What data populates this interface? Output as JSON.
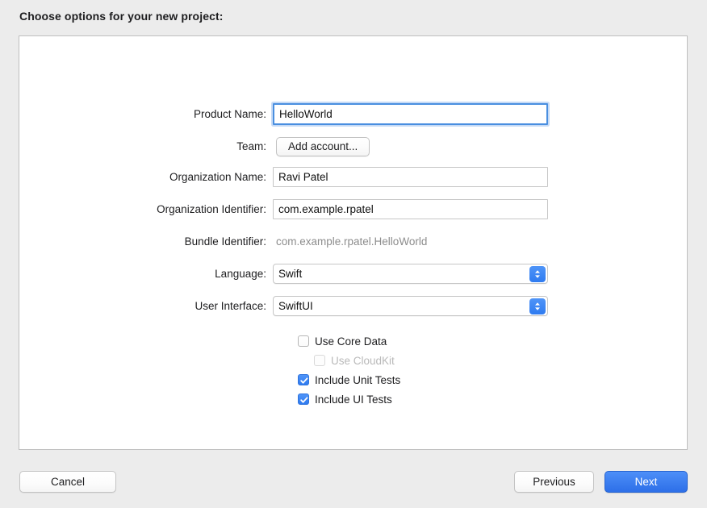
{
  "dialog": {
    "title": "Choose options for your new project:"
  },
  "form": {
    "fields": [
      {
        "label": "Product Name:",
        "type": "textfield",
        "value": "HelloWorld",
        "focused": true
      },
      {
        "label": "Team:",
        "type": "button",
        "value": "Add account..."
      },
      {
        "label": "Organization Name:",
        "type": "textfield",
        "value": "Ravi Patel",
        "focused": false
      },
      {
        "label": "Organization Identifier:",
        "type": "textfield",
        "value": "com.example.rpatel",
        "focused": false
      },
      {
        "label": "Bundle Identifier:",
        "type": "static",
        "value": "com.example.rpatel.HelloWorld"
      },
      {
        "label": "Language:",
        "type": "popup",
        "value": "Swift"
      },
      {
        "label": "User Interface:",
        "type": "popup",
        "value": "SwiftUI"
      }
    ],
    "checkboxes": [
      {
        "label": "Use Core Data",
        "checked": false,
        "disabled": false,
        "indent": false
      },
      {
        "label": "Use CloudKit",
        "checked": false,
        "disabled": true,
        "indent": true
      },
      {
        "label": "Include Unit Tests",
        "checked": true,
        "disabled": false,
        "indent": false
      },
      {
        "label": "Include UI Tests",
        "checked": true,
        "disabled": false,
        "indent": false
      }
    ]
  },
  "footer": {
    "cancel_label": "Cancel",
    "previous_label": "Previous",
    "next_label": "Next"
  },
  "colors": {
    "accent": "#2f7bf0",
    "focus_ring": "#4a8fe0",
    "window_background": "#ececec",
    "panel_background": "#ffffff",
    "disabled_text": "#b9b9b9",
    "static_text": "#8d8d8d"
  }
}
